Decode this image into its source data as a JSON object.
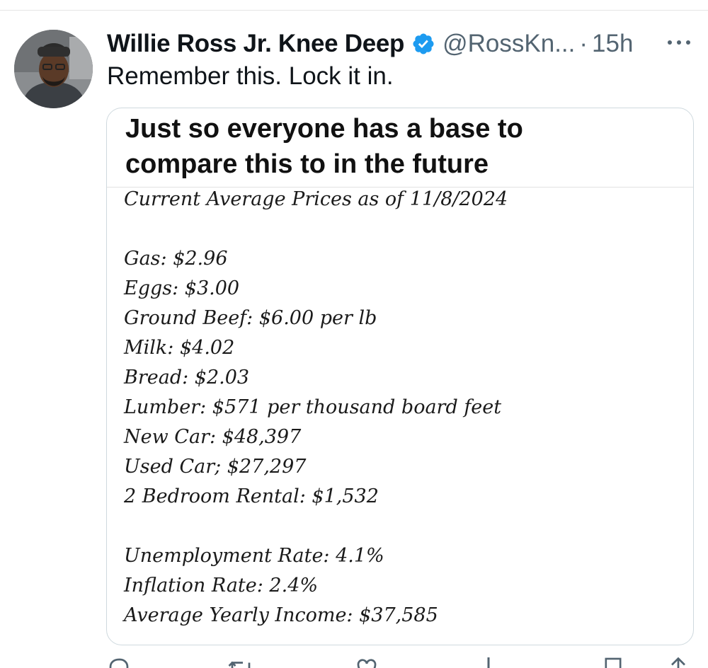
{
  "tweet": {
    "display_name": "Willie Ross Jr. Knee Deep",
    "handle": "@RossKn...",
    "separator": "·",
    "time": "15h",
    "text": "Remember this. Lock it in.",
    "icons": {
      "verified": "verified-badge-icon",
      "more": "more-options-icon",
      "avatar": "user-avatar"
    },
    "colors": {
      "verified": "#1d9bf0",
      "secondary_text": "#536471",
      "border": "#cfd9de"
    }
  },
  "card": {
    "title_line1": "Just so everyone has a base to",
    "title_line2": "compare this to in the future",
    "heading": "Current Average Prices as of 11/8/2024",
    "prices": [
      "Gas: $2.96",
      "Eggs: $3.00",
      "Ground Beef: $6.00 per lb",
      "Milk: $4.02",
      "Bread: $2.03",
      "Lumber: $571 per thousand board feet",
      "New Car: $48,397",
      "Used Car; $27,297",
      "2 Bedroom Rental: $1,532"
    ],
    "rates": [
      "Unemployment Rate: 4.1%",
      "Inflation Rate: 2.4%",
      "Average Yearly Income: $37,585"
    ]
  },
  "actions": {
    "icons": [
      "reply-icon",
      "retweet-icon",
      "like-icon",
      "views-icon",
      "bookmark-icon",
      "share-icon"
    ]
  }
}
